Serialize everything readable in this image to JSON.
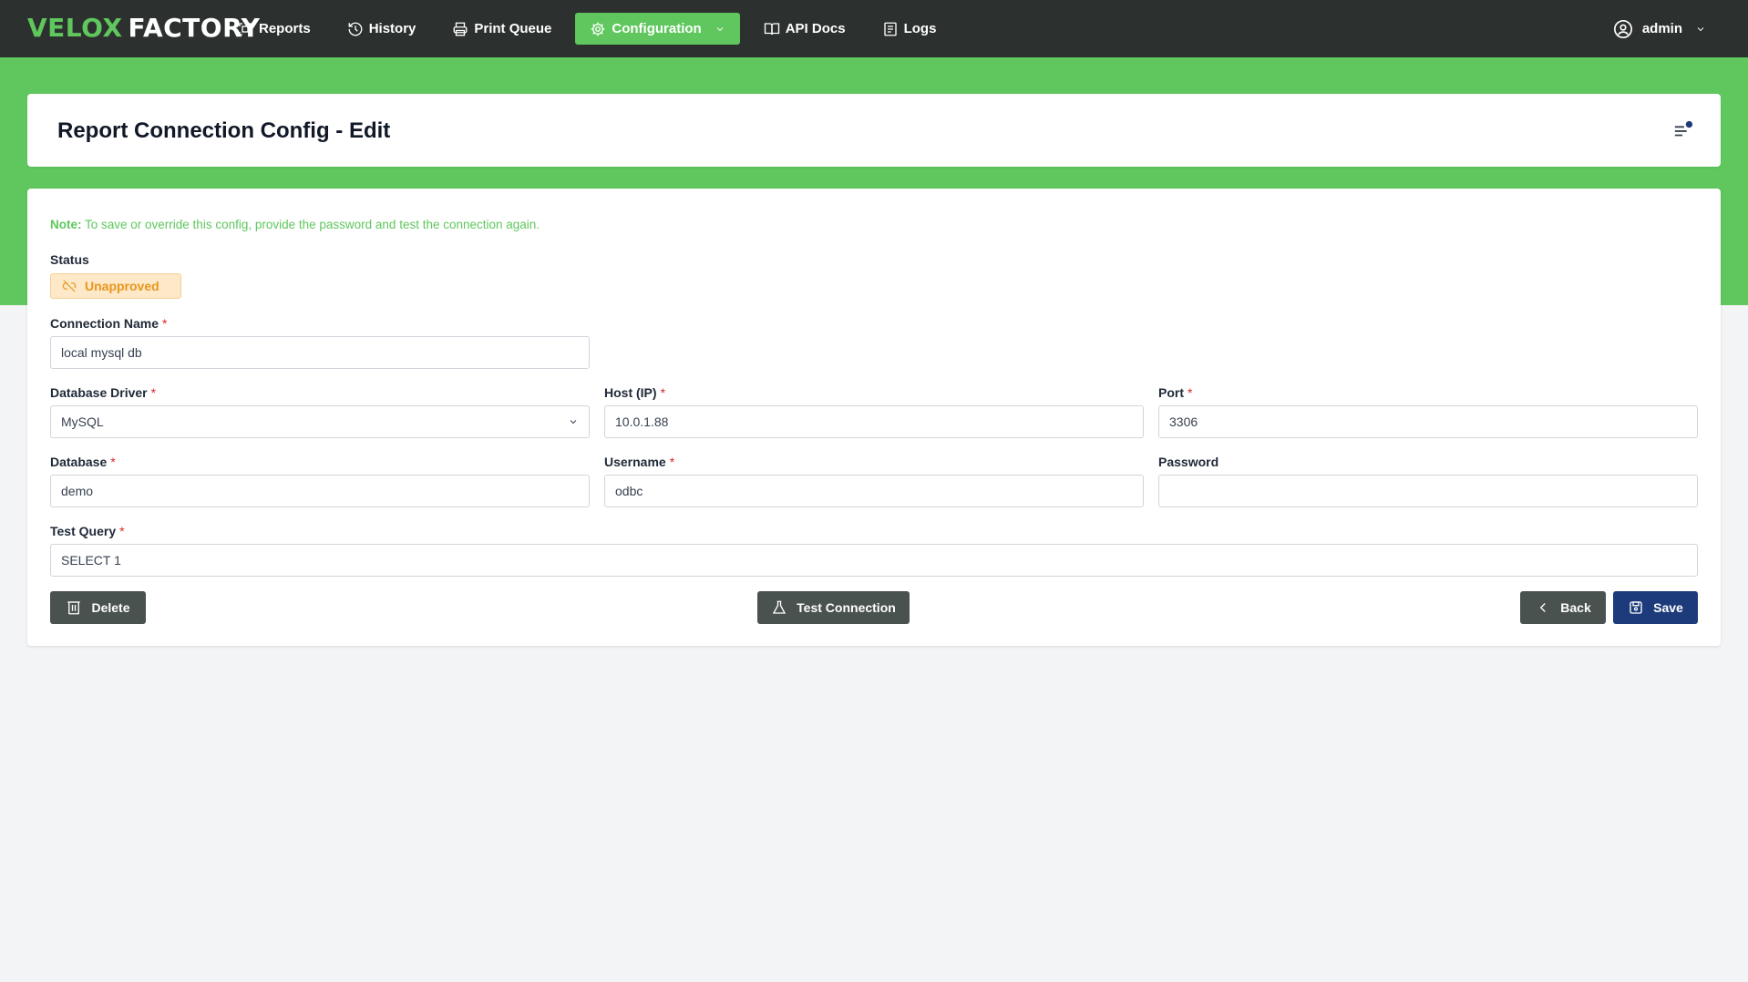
{
  "brand": {
    "part1": "VELOX",
    "part2": "FACTORY"
  },
  "nav": {
    "items": [
      {
        "label": "Reports",
        "icon": "scan-icon"
      },
      {
        "label": "History",
        "icon": "history-icon"
      },
      {
        "label": "Print Queue",
        "icon": "printer-icon"
      },
      {
        "label": "Configuration",
        "icon": "gear-icon",
        "active": true
      },
      {
        "label": "API Docs",
        "icon": "book-icon"
      },
      {
        "label": "Logs",
        "icon": "log-icon"
      }
    ],
    "user": "admin"
  },
  "page": {
    "title": "Report Connection Config - Edit"
  },
  "form": {
    "note_prefix": "Note:",
    "note_text": " To save or override this config, provide the password and test the connection again.",
    "status_label": "Status",
    "status_value": "Unapproved",
    "connection_name": {
      "label": "Connection Name",
      "value": "local mysql db"
    },
    "database_driver": {
      "label": "Database Driver",
      "value": "MySQL"
    },
    "host": {
      "label": "Host (IP)",
      "value": "10.0.1.88"
    },
    "port": {
      "label": "Port",
      "value": "3306"
    },
    "database": {
      "label": "Database",
      "value": "demo"
    },
    "username": {
      "label": "Username",
      "value": "odbc"
    },
    "password": {
      "label": "Password",
      "value": ""
    },
    "test_query": {
      "label": "Test Query",
      "value": "SELECT 1"
    },
    "required_mark": "*"
  },
  "actions": {
    "delete": "Delete",
    "test_connection": "Test Connection",
    "back": "Back",
    "save": "Save"
  },
  "colors": {
    "brand_green": "#5fc75d",
    "navbar_bg": "#2c312f",
    "status_warning": "#e8971d",
    "save_navy": "#1d3b7a",
    "button_dark": "#4a5250"
  }
}
